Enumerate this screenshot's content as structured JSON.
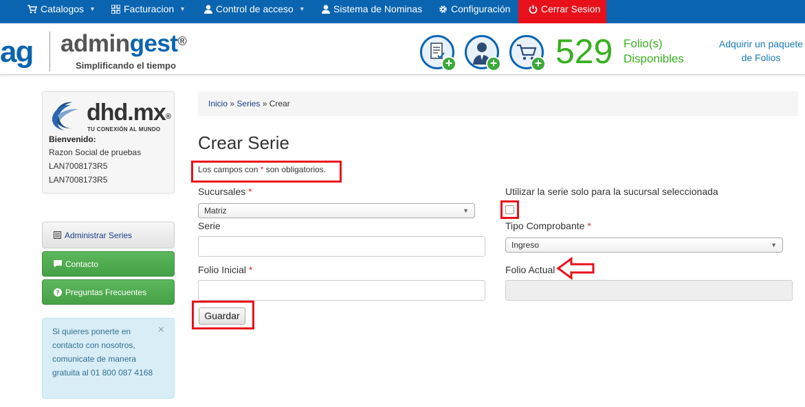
{
  "topnav": {
    "items": [
      {
        "label": "Catalogos",
        "icon": "cart-icon"
      },
      {
        "label": "Facturacion",
        "icon": "grid-icon"
      },
      {
        "label": "Control de acceso",
        "icon": "user-icon"
      },
      {
        "label": "Sistema de Nominas",
        "icon": "user-icon"
      },
      {
        "label": "Configuración",
        "icon": "gear-icon"
      }
    ],
    "logout": {
      "label": "Cerrar Sesion",
      "icon": "power-icon"
    },
    "colors": {
      "bar": "#0a64b0",
      "logout": "#e8101a"
    }
  },
  "header": {
    "logo_short": "ag",
    "logo_name_a": "admin",
    "logo_name_b": "gest",
    "logo_reg": "®",
    "tagline": "Simplificando el tiempo",
    "icons": [
      "document-add-icon",
      "user-add-icon",
      "cart-add-icon"
    ],
    "folio_count": "529",
    "folio_label_1": "Folio(s)",
    "folio_label_2": "Disponibles",
    "buy_link": "Adquirir un paquete de Folios",
    "accent_green": "#37b01e"
  },
  "sidebar": {
    "company_logo": "dhd.mx",
    "company_reg": "®",
    "company_tagline": "TU CONEXIÓN AL MUNDO",
    "welcome": "Bienvenido:",
    "razon_social": "Razon Social de pruebas",
    "rfc_1": "LAN7008173R5",
    "rfc_2": "LAN7008173R5",
    "buttons": [
      {
        "label": "Administrar Series",
        "icon": "list-icon"
      },
      {
        "label": "Contacto",
        "icon": "comment-icon"
      },
      {
        "label": "Preguntas Frecuentes",
        "icon": "question-icon"
      }
    ],
    "info": "Si quieres ponerte en contacto con nosotros, comunicate de manera gratuita al 01 800 087 4168",
    "info_close": "×"
  },
  "main": {
    "breadcrumb": {
      "home": "Inicio",
      "sep": "»",
      "series": "Series",
      "current": "Crear"
    },
    "title": "Crear Serie",
    "required_note_a": "Los campos con",
    "required_star": "*",
    "required_note_b": "son obligatorios.",
    "form": {
      "sucursales_label": "Sucursales",
      "sucursales_value": "Matriz",
      "solo_sucursal_label": "Utilizar la serie solo para la sucursal seleccionada",
      "solo_sucursal_checked": false,
      "serie_label": "Serie",
      "serie_value": "",
      "tipo_label": "Tipo Comprobante",
      "tipo_value": "Ingreso",
      "folio_inicial_label": "Folio Inicial",
      "folio_inicial_value": "",
      "folio_actual_label": "Folio Actual",
      "folio_actual_value": "",
      "save_label": "Guardar"
    }
  }
}
